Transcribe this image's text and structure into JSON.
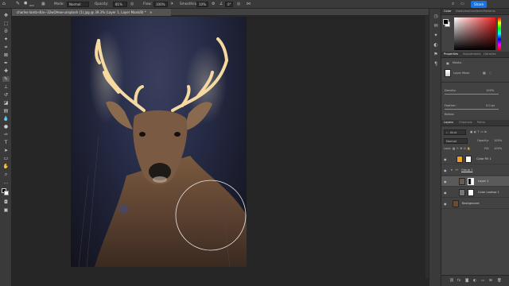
{
  "options_bar": {
    "tool_size": "800",
    "mode_label": "Mode:",
    "mode_value": "Normal",
    "opacity_label": "Opacity:",
    "opacity_value": "81%",
    "flow_label": "Flow:",
    "flow_value": "100%",
    "smoothing_label": "Smoothing:",
    "smoothing_value": "10%",
    "angle_value": "0°",
    "share_label": "Share"
  },
  "document_tab": {
    "title": "charles-lamb-dUx--32wOAew-unsplash (1).jpg @ 39.3% (Layer 1, Layer Mask/8) *",
    "close": "×"
  },
  "tools": [
    "move",
    "marquee",
    "lasso",
    "magic-wand",
    "crop",
    "frame",
    "eyedropper",
    "spot-heal",
    "brush",
    "clone-stamp",
    "history-brush",
    "eraser",
    "gradient",
    "blur",
    "dodge",
    "pen",
    "type",
    "path-select",
    "rectangle",
    "hand",
    "zoom",
    "more"
  ],
  "color_panel": {
    "tabs": [
      "Color",
      "Swatches",
      "Gradients",
      "Patterns"
    ],
    "foreground": "#000000",
    "background": "#ffffff",
    "hue_marker": "#cc1a1a"
  },
  "properties_panel": {
    "tabs": [
      "Properties",
      "Adjustments",
      "Libraries"
    ],
    "masks_label": "Masks",
    "layer_mask_label": "Layer Mask",
    "density_label": "Density:",
    "density_value": "100%",
    "feather_label": "Feather:",
    "feather_value": "0.0 px",
    "refine_label": "Refine:"
  },
  "layers_panel": {
    "tabs": [
      "Layers",
      "Channels",
      "Paths"
    ],
    "filter_kind": "Kind",
    "blend_mode": "Normal",
    "opacity_label": "Opacity:",
    "opacity_value": "100%",
    "lock_label": "Lock:",
    "fill_label": "Fill:",
    "fill_value": "100%",
    "layers": [
      {
        "name": "Color Fill 1",
        "thumb": "#f0a020"
      },
      {
        "name": "Group 1",
        "thumb": "#7a6a40"
      },
      {
        "name": "Layer 1",
        "thumb": "#6a5a4a"
      },
      {
        "name": "Color Lookup 1",
        "thumb": "#777777"
      },
      {
        "name": "Background",
        "thumb": "#6a4a30"
      }
    ],
    "footer_icons": [
      "link-icon",
      "fx-icon",
      "mask-icon",
      "adjustment-icon",
      "folder-icon",
      "new-layer-icon",
      "trash-icon"
    ]
  }
}
